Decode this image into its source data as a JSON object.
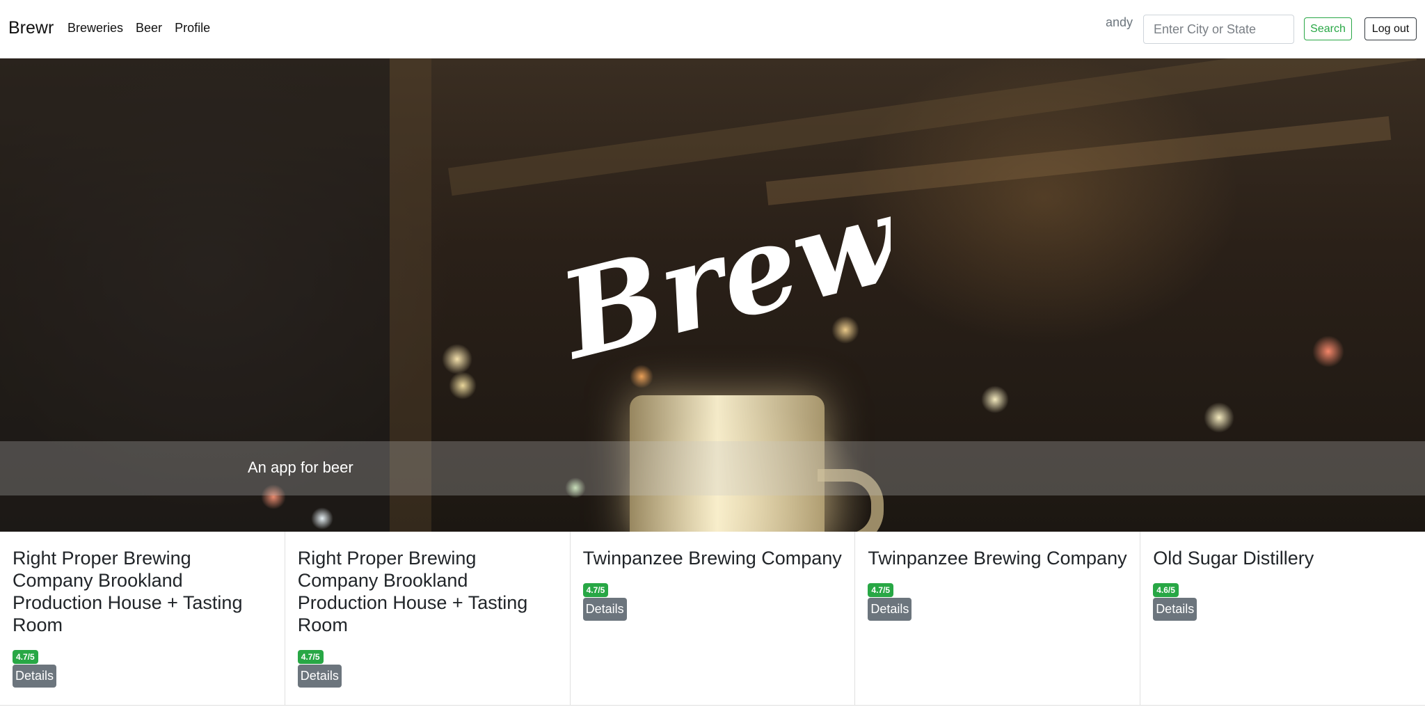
{
  "navbar": {
    "brand": "Brewr",
    "links": [
      "Breweries",
      "Beer",
      "Profile"
    ],
    "username": "andy",
    "search_placeholder": "Enter City or State",
    "search_label": "Search",
    "logout_label": "Log out"
  },
  "hero": {
    "logo_text": "Brewr",
    "caption": "An app for beer"
  },
  "breweries": [
    {
      "name": "Right Proper Brewing Company Brookland Production House + Tasting Room",
      "rating": "4.7/5",
      "details_label": "Details"
    },
    {
      "name": "Right Proper Brewing Company Brookland Production House + Tasting Room",
      "rating": "4.7/5",
      "details_label": "Details"
    },
    {
      "name": "Twinpanzee Brewing Company",
      "rating": "4.7/5",
      "details_label": "Details"
    },
    {
      "name": "Twinpanzee Brewing Company",
      "rating": "4.7/5",
      "details_label": "Details"
    },
    {
      "name": "Old Sugar Distillery",
      "rating": "4.6/5",
      "details_label": "Details"
    }
  ],
  "colors": {
    "success": "#28a745",
    "secondary": "#6c757d",
    "dark": "#343a40"
  }
}
